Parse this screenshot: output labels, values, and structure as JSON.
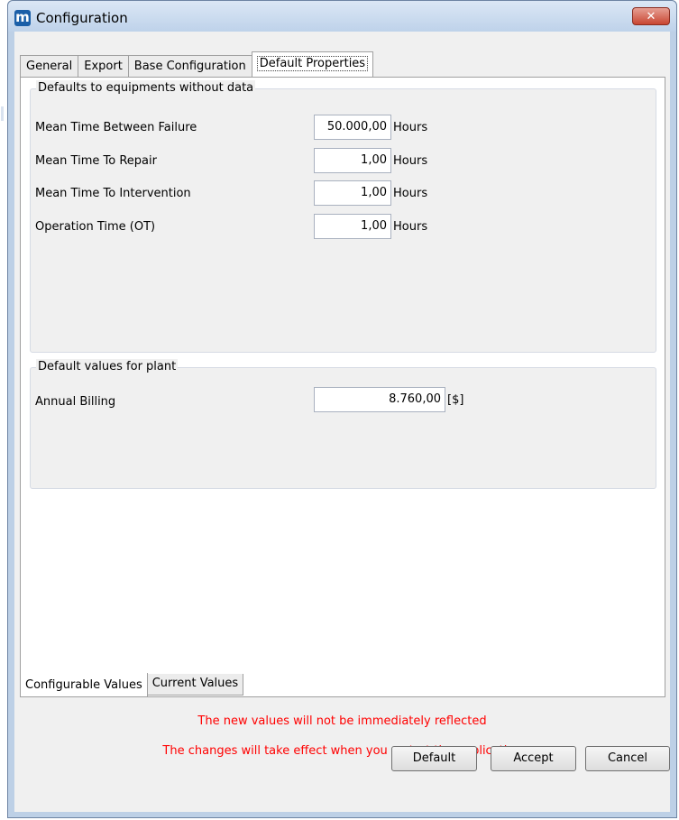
{
  "window": {
    "title": "Configuration",
    "close_glyph": "✕",
    "app_icon_letter": "m"
  },
  "tabs": [
    {
      "label": "General",
      "active": false
    },
    {
      "label": "Export",
      "active": false
    },
    {
      "label": "Base Configuration",
      "active": false
    },
    {
      "label": "Default Properties",
      "active": true
    }
  ],
  "group_equipment": {
    "title": "Defaults to equipments without data",
    "rows": [
      {
        "label": "Mean Time Between Failure",
        "value": "50.000,00",
        "unit": "Hours"
      },
      {
        "label": "Mean Time To Repair",
        "value": "1,00",
        "unit": "Hours"
      },
      {
        "label": "Mean Time To Intervention",
        "value": "1,00",
        "unit": "Hours"
      },
      {
        "label": "Operation Time (OT)",
        "value": "1,00",
        "unit": "Hours"
      }
    ]
  },
  "group_plant": {
    "title": "Default values for plant",
    "rows": [
      {
        "label": "Annual Billing",
        "value": "8.760,00",
        "unit": "[$]"
      }
    ]
  },
  "bottom_tabs": [
    {
      "label": "Configurable Values",
      "active": true
    },
    {
      "label": "Current Values",
      "active": false
    }
  ],
  "notices": {
    "line1": "The new values will not be immediately reflected",
    "line2": "The changes will take effect when you restart the application"
  },
  "buttons": {
    "default": "Default",
    "accept": "Accept",
    "cancel": "Cancel"
  },
  "colors": {
    "notice": "#ff0000",
    "close_button": "#c94632",
    "title_bar": "#bed2ea"
  }
}
